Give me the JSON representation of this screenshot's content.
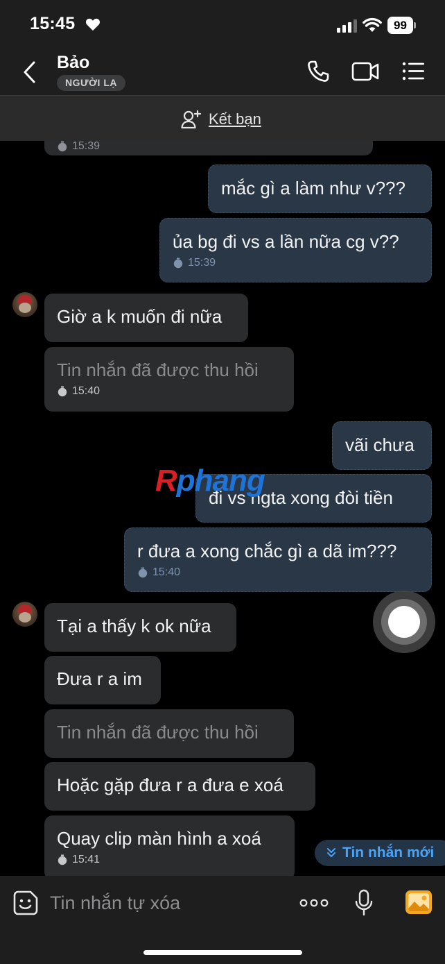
{
  "status_bar": {
    "time": "15:45",
    "battery": "99"
  },
  "header": {
    "contact_name": "Bảo",
    "badge": "NGƯỜI LẠ",
    "add_friend_label": "Kết bạn"
  },
  "messages": [
    {
      "side": "sent",
      "text": "mắc gì a làm như v???"
    },
    {
      "side": "sent",
      "text": "ủa bg đi vs a lần nữa cg v??",
      "time": "15:39"
    },
    {
      "side": "recv",
      "text": "Giờ a k muốn đi nữa"
    },
    {
      "side": "recv",
      "text": "Tin nhắn đã được thu hồi",
      "recalled": true,
      "time": "15:40"
    },
    {
      "side": "sent",
      "text": "vãi chưa"
    },
    {
      "side": "sent",
      "text": "đi vs ngta xong đòi tiền"
    },
    {
      "side": "sent",
      "text": "r đưa a xong chắc gì a dã im???",
      "time": "15:40"
    },
    {
      "side": "recv",
      "text": "Tại a thấy k ok nữa"
    },
    {
      "side": "recv",
      "text": "Đưa r a im"
    },
    {
      "side": "recv",
      "text": "Tin nhắn đã được thu hồi",
      "recalled": true
    },
    {
      "side": "recv",
      "text": "Hoặc gặp đưa r a đưa e xoá"
    },
    {
      "side": "recv",
      "text": "Quay clip màn hình a xoá",
      "time": "15:41"
    }
  ],
  "partial_top_time": "15:39",
  "watermark": {
    "first": "R",
    "rest": "phang"
  },
  "new_messages_label": "Tin nhắn mới",
  "composer": {
    "placeholder": "Tin nhắn tự xóa"
  },
  "icons": {
    "back": "chevron-left-icon",
    "call": "phone-icon",
    "video": "video-camera-icon",
    "menu": "list-menu-icon",
    "add_friend": "add-user-icon",
    "sticker": "sticker-face-icon",
    "more": "ellipsis-icon",
    "mic": "microphone-icon",
    "photo": "image-icon"
  },
  "colors": {
    "sent_bubble": "#2a3746",
    "received_bubble": "#2b2c2e",
    "accent": "#4aa3f5",
    "photo_icon": "#f5a623"
  }
}
